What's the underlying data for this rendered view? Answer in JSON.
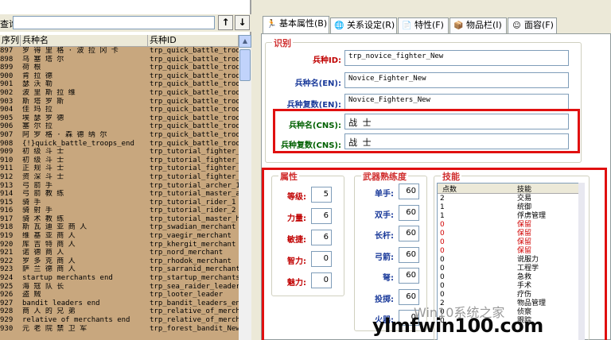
{
  "search": {
    "label": "查询:",
    "value": "",
    "up_label": "↑",
    "down_label": "↓"
  },
  "list": {
    "columns": [
      "序列",
      "兵种名",
      "兵种ID"
    ],
    "rows": [
      {
        "seq": "897",
        "name": "罗 得 里 格 · 波 拉 冈 卡",
        "id": "trp_quick_battle_troop"
      },
      {
        "seq": "898",
        "name": "乌 塞 塔 尔",
        "id": "trp_quick_battle_troop"
      },
      {
        "seq": "899",
        "name": "荷 根",
        "id": "trp_quick_battle_troop"
      },
      {
        "seq": "900",
        "name": "肯 拉 德",
        "id": "trp_quick_battle_troop"
      },
      {
        "seq": "901",
        "name": "瑟 沃 勒",
        "id": "trp_quick_battle_troop"
      },
      {
        "seq": "902",
        "name": "波 里 斯 拉 维",
        "id": "trp_quick_battle_troop"
      },
      {
        "seq": "903",
        "name": "斯 塔 罗 斯",
        "id": "trp_quick_battle_troop"
      },
      {
        "seq": "904",
        "name": "佳 玛 拉",
        "id": "trp_quick_battle_troop"
      },
      {
        "seq": "905",
        "name": "埃 瑟 罗 德",
        "id": "trp_quick_battle_troop"
      },
      {
        "seq": "906",
        "name": "塞 尔 拉",
        "id": "trp_quick_battle_troop"
      },
      {
        "seq": "907",
        "name": "阿 罗 格 · 森 德 纳 尔",
        "id": "trp_quick_battle_troop"
      },
      {
        "seq": "908",
        "name": "{!}quick_battle_troops_end",
        "id": "trp_quick_battle_troop"
      },
      {
        "seq": "909",
        "name": "初 级 斗 士",
        "id": "trp_tutorial_fighter_1"
      },
      {
        "seq": "910",
        "name": "初 级 斗 士",
        "id": "trp_tutorial_fighter_2"
      },
      {
        "seq": "911",
        "name": "正 规 斗 士",
        "id": "trp_tutorial_fighter_3"
      },
      {
        "seq": "912",
        "name": "资 深 斗 士",
        "id": "trp_tutorial_fighter_4"
      },
      {
        "seq": "913",
        "name": "弓 箭 手",
        "id": "trp_tutorial_archer_1"
      },
      {
        "seq": "914",
        "name": "弓 箭 教 练",
        "id": "trp_tutorial_master_ar"
      },
      {
        "seq": "915",
        "name": "骑 手",
        "id": "trp_tutorial_rider_1"
      },
      {
        "seq": "916",
        "name": "骑 射 手",
        "id": "trp_tutorial_rider_2"
      },
      {
        "seq": "917",
        "name": "骑 术 教 练",
        "id": "trp_tutorial_master_ho"
      },
      {
        "seq": "918",
        "name": "斯 瓦 迪 亚 商 人",
        "id": "trp_swadian_merchant"
      },
      {
        "seq": "919",
        "name": "维 基 亚 商 人",
        "id": "trp_vaegir_merchant"
      },
      {
        "seq": "920",
        "name": "库 吉 特 商 人",
        "id": "trp_khergit_merchant"
      },
      {
        "seq": "921",
        "name": "诺 德 商 人",
        "id": "trp_nord_merchant"
      },
      {
        "seq": "922",
        "name": "罗 多 克 商 人",
        "id": "trp_rhodok_merchant"
      },
      {
        "seq": "923",
        "name": "萨 兰 德 商 人",
        "id": "trp_sarranid_merchant"
      },
      {
        "seq": "924",
        "name": "startup merchants end",
        "id": "trp_startup_merchants_"
      },
      {
        "seq": "925",
        "name": "海 寇 队 长",
        "id": "trp_sea_raider_leader"
      },
      {
        "seq": "926",
        "name": "盗 贼",
        "id": "trp_looter_leader"
      },
      {
        "seq": "927",
        "name": "bandit leaders end",
        "id": "trp_bandit_leaders_end"
      },
      {
        "seq": "928",
        "name": "商 人 的 兄 弟",
        "id": "trp_relative_of_merchan"
      },
      {
        "seq": "929",
        "name": "relative of merchants end",
        "id": "trp_relative_of_merchan"
      },
      {
        "seq": "930",
        "name": "元 老 院 禁 卫 军",
        "id": "trp_forest_bandit_New"
      }
    ]
  },
  "tabs": [
    {
      "label": "基本属性(B)",
      "icon": "person-icon"
    },
    {
      "label": "关系设定(R)",
      "icon": "globe-icon"
    },
    {
      "label": "特性(F)",
      "icon": "note-icon"
    },
    {
      "label": "物品栏(I)",
      "icon": "box-icon"
    },
    {
      "label": "面容(F)",
      "icon": "smiley-icon"
    }
  ],
  "identity": {
    "title": "识别",
    "id_label": "兵种ID:",
    "id_value": "trp_novice_fighter_New",
    "name_en_label": "兵种名(EN):",
    "name_en_value": "Novice_Fighter_New",
    "plural_en_label": "兵种复数(EN):",
    "plural_en_value": "Novice_Fighters_New",
    "name_cn_label": "兵种名(CNS):",
    "name_cn_value": "战 士",
    "plural_cn_label": "兵种复数(CNS):",
    "plural_cn_value": "战 士"
  },
  "attributes": {
    "title": "属性",
    "items": [
      {
        "label": "等级:",
        "value": "5"
      },
      {
        "label": "力量:",
        "value": "6"
      },
      {
        "label": "敏捷:",
        "value": "6"
      },
      {
        "label": "智力:",
        "value": "0"
      },
      {
        "label": "魅力:",
        "value": "0"
      }
    ]
  },
  "weapons": {
    "title": "武器熟练度",
    "items": [
      {
        "label": "单手:",
        "value": "60"
      },
      {
        "label": "双手:",
        "value": "60"
      },
      {
        "label": "长杆:",
        "value": "60"
      },
      {
        "label": "弓箭:",
        "value": "60"
      },
      {
        "label": "弩:",
        "value": "60"
      },
      {
        "label": "投掷:",
        "value": "60"
      },
      {
        "label": "火器:",
        "value": "0"
      }
    ]
  },
  "skills": {
    "title": "技能",
    "columns": [
      "点数",
      "技能"
    ],
    "rows": [
      {
        "points": "2",
        "name": "交易",
        "color": "#000000"
      },
      {
        "points": "1",
        "name": "统御",
        "color": "#000000"
      },
      {
        "points": "1",
        "name": "俘虏管理",
        "color": "#000000"
      },
      {
        "points": "0",
        "name": "保留",
        "color": "#d00000"
      },
      {
        "points": "0",
        "name": "保留",
        "color": "#d00000"
      },
      {
        "points": "0",
        "name": "保留",
        "color": "#d00000"
      },
      {
        "points": "0",
        "name": "保留",
        "color": "#d00000"
      },
      {
        "points": "0",
        "name": "说服力",
        "color": "#000000"
      },
      {
        "points": "0",
        "name": "工程学",
        "color": "#000000"
      },
      {
        "points": "0",
        "name": "急救",
        "color": "#000000"
      },
      {
        "points": "0",
        "name": "手术",
        "color": "#000000"
      },
      {
        "points": "0",
        "name": "疗伤",
        "color": "#000000"
      },
      {
        "points": "2",
        "name": "物品管理",
        "color": "#000000"
      },
      {
        "points": "0",
        "name": "侦察",
        "color": "#000000"
      },
      {
        "points": "0",
        "name": "跟踪",
        "color": "#000000"
      }
    ]
  },
  "watermark": {
    "main": "ylmfwin100.com",
    "sub": "Win10系统之家"
  },
  "colors": {
    "accent_red": "#e01010",
    "list_bg": "#c8a77e",
    "label_blue": "#1a3a9a"
  }
}
